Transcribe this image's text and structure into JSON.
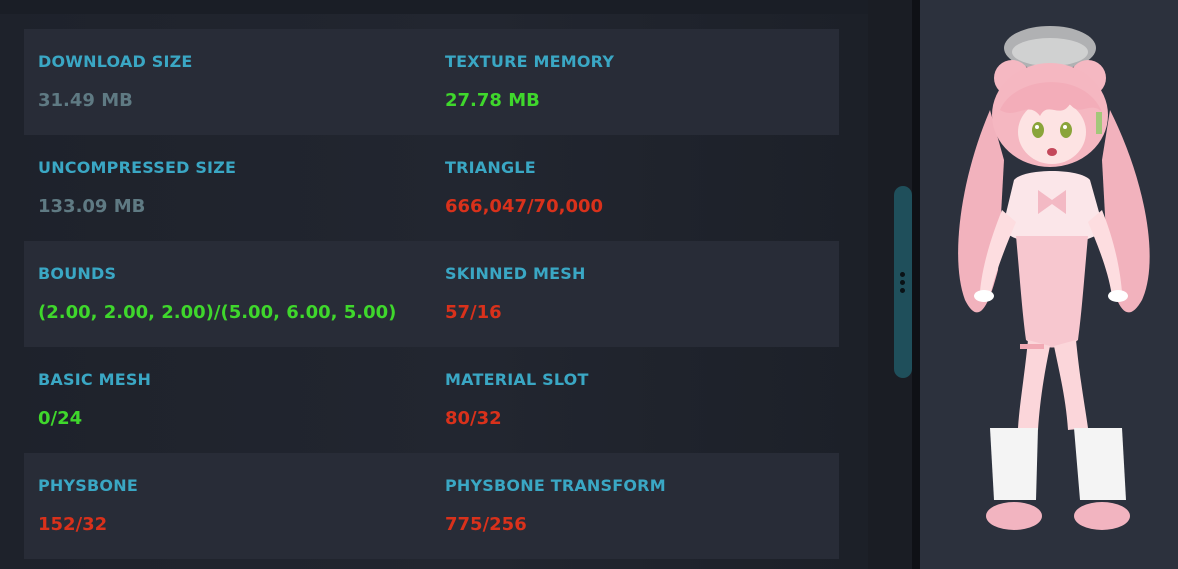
{
  "stats": [
    {
      "label": "DOWNLOAD SIZE",
      "value": "31.49 MB",
      "status": "neutral"
    },
    {
      "label": "TEXTURE MEMORY",
      "value": "27.78 MB",
      "status": "good"
    },
    {
      "label": "UNCOMPRESSED SIZE",
      "value": "133.09 MB",
      "status": "neutral"
    },
    {
      "label": "TRIANGLE",
      "value": "666,047/70,000",
      "status": "bad"
    },
    {
      "label": "BOUNDS",
      "value": "(2.00, 2.00, 2.00)/(5.00, 6.00, 5.00)",
      "status": "good"
    },
    {
      "label": "SKINNED MESH",
      "value": "57/16",
      "status": "bad"
    },
    {
      "label": "BASIC MESH",
      "value": "0/24",
      "status": "good"
    },
    {
      "label": "MATERIAL SLOT",
      "value": "80/32",
      "status": "bad"
    },
    {
      "label": "PHYSBONE",
      "value": "152/32",
      "status": "bad"
    },
    {
      "label": "PHYSBONE TRANSFORM",
      "value": "775/256",
      "status": "bad"
    }
  ],
  "colors": {
    "label": "#3aa7c4",
    "neutral": "#5f7a83",
    "good": "#3fd72c",
    "bad": "#d9311b"
  },
  "preview": {
    "figure": "pink-haired-avatar"
  }
}
